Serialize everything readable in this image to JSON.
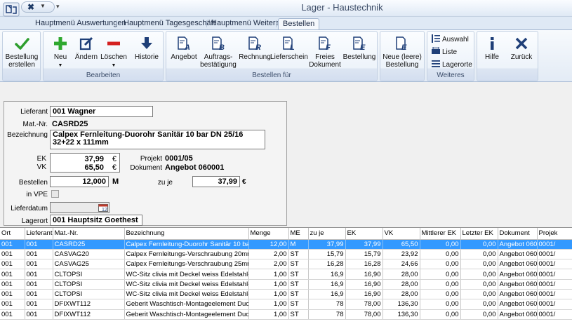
{
  "window": {
    "title": "Lager - Haustechnik"
  },
  "tabs": [
    {
      "label": "Hauptmenü Auswertungen"
    },
    {
      "label": "Hauptmenü Tagesgeschäft"
    },
    {
      "label": "Hauptmenü Weiteres"
    },
    {
      "label": "Bestellen"
    }
  ],
  "ribbon": {
    "bestellung_erstellen": {
      "line1": "Bestellung",
      "line2": "erstellen"
    },
    "bearbeiten": {
      "label": "Bearbeiten",
      "neu": "Neu",
      "aendern": "Ändern",
      "loeschen": "Löschen",
      "historie": "Historie"
    },
    "bestellen_fuer": {
      "label": "Bestellen für",
      "angebot": "Angebot",
      "auftrag": {
        "line1": "Auftrags-",
        "line2": "bestätigung"
      },
      "rechnung": "Rechnung",
      "lieferschein": "Lieferschein",
      "freies": {
        "line1": "Freies",
        "line2": "Dokument"
      },
      "bestellung": "Bestellung"
    },
    "neue_bestellung": {
      "line1": "Neue (leere)",
      "line2": "Bestellung"
    },
    "weiteres": {
      "label": "Weiteres",
      "auswahl": "Auswahl",
      "liste": "Liste",
      "lagerorte": "Lagerorte"
    },
    "hilfe": "Hilfe",
    "zurueck": "Zurück"
  },
  "form": {
    "lieferant_label": "Lieferant",
    "lieferant": "001 Wagner",
    "matnr_label": "Mat.-Nr.",
    "matnr": "CASRD25",
    "bezeichnung_label": "Bezeichnung",
    "bezeichnung": "Calpex Fernleitung-Duorohr Sanitär 10 bar DN 25/16  32+22 x 111mm",
    "ek_label": "EK",
    "ek": "37,99",
    "vk_label": "VK",
    "vk": "65,50",
    "currency": "€",
    "projekt_label": "Projekt",
    "projekt": "0001/05",
    "dokument_label": "Dokument",
    "dokument": "Angebot 060001",
    "bestellen_label": "Bestellen",
    "bestellen": "12,000",
    "unit": "M",
    "zuje_label": "zu je",
    "zuje": "37,99",
    "invpe_label": "in VPE",
    "lieferdatum_label": "Lieferdatum",
    "lieferdatum": "",
    "lagerort_label": "Lagerort",
    "lagerort": "001 Hauptsitz Goethest"
  },
  "grid": {
    "columns": [
      "Ort",
      "Lieferant",
      "Mat.-Nr.",
      "Bezeichnung",
      "Menge",
      "ME",
      "zu je",
      "EK",
      "VK",
      "Mittlerer EK",
      "Letzter EK",
      "Dokument",
      "Projek"
    ],
    "rows": [
      [
        "001",
        "001",
        "CASRD25",
        "Calpex Fernleitung-Duorohr Sanitär 10 bar DN 25/1",
        "12,00",
        "M",
        "37,99",
        "37,99",
        "65,50",
        "0,00",
        "0,00",
        "Angebot 060",
        "0001/"
      ],
      [
        "001",
        "001",
        "CASVAG20",
        "Calpex Fernleitungs-Verschraubung 20mm 28 x 4,0",
        "2,00",
        "ST",
        "15,79",
        "15,79",
        "23,92",
        "0,00",
        "0,00",
        "Angebot 060",
        "0001/"
      ],
      [
        "001",
        "001",
        "CASVAG25",
        "Calpex Fernleitungs-Verschraubung 25mm 32 x 4,4",
        "2,00",
        "ST",
        "16,28",
        "16,28",
        "24,66",
        "0,00",
        "0,00",
        "Angebot 060",
        "0001/"
      ],
      [
        "001",
        "001",
        "CLTOPSI",
        "WC-Sitz clivia mit Deckel weiss Edelstahl-Scharnier",
        "1,00",
        "ST",
        "16,9",
        "16,90",
        "28,00",
        "0,00",
        "0,00",
        "Angebot 060",
        "0001/"
      ],
      [
        "001",
        "001",
        "CLTOPSI",
        "WC-Sitz clivia mit Deckel weiss Edelstahl-Scharnier",
        "1,00",
        "ST",
        "16,9",
        "16,90",
        "28,00",
        "0,00",
        "0,00",
        "Angebot 060",
        "0001/"
      ],
      [
        "001",
        "001",
        "CLTOPSI",
        "WC-Sitz clivia mit Deckel weiss Edelstahl-Scharnier",
        "1,00",
        "ST",
        "16,9",
        "16,90",
        "28,00",
        "0,00",
        "0,00",
        "Angebot 060",
        "0001/"
      ],
      [
        "001",
        "001",
        "DFIXWT112",
        "Geberit Waschtisch-Montageelement Duofix Bauhö",
        "1,00",
        "ST",
        "78",
        "78,00",
        "136,30",
        "0,00",
        "0,00",
        "Angebot 060",
        "0001/"
      ],
      [
        "001",
        "001",
        "DFIXWT112",
        "Geberit Waschtisch-Montageelement Duofix Bauhö",
        "1,00",
        "ST",
        "78",
        "78,00",
        "136,30",
        "0,00",
        "0,00",
        "Angebot 060",
        "0001/"
      ]
    ],
    "selected_row": 0
  },
  "colors": {
    "accent": "#3399ff",
    "ribbon_text": "#3c4d6a",
    "icon_blue": "#1f3f78",
    "check_green": "#2e9e2e",
    "plus_green": "#2fa82f",
    "minus_red": "#d42020"
  }
}
